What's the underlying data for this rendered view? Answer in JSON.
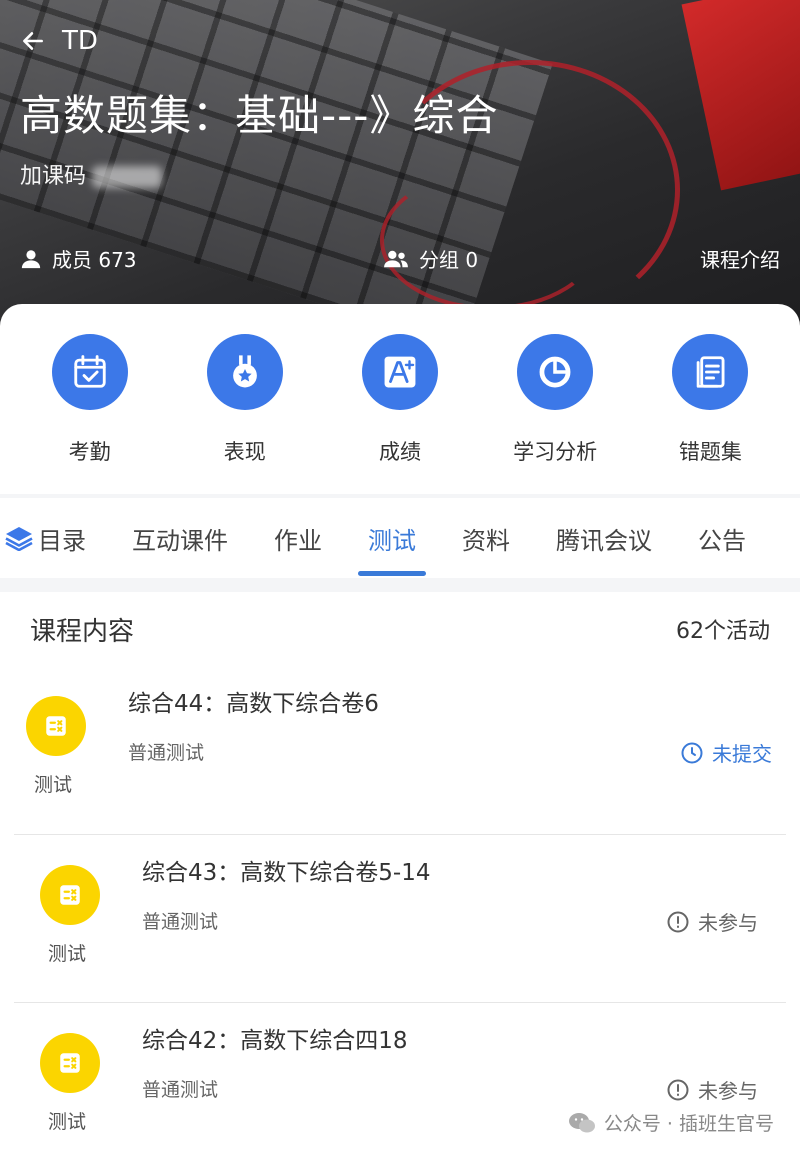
{
  "header": {
    "back_label": "TD",
    "title": "高数题集：基础---》综合",
    "course_code_label": "加课码",
    "members_label": "成员 673",
    "groups_label": "分组 0",
    "intro_label": "课程介绍"
  },
  "actions": [
    {
      "label": "考勤",
      "icon": "calendar-check-icon"
    },
    {
      "label": "表现",
      "icon": "medal-icon"
    },
    {
      "label": "成绩",
      "icon": "grade-a-plus-icon"
    },
    {
      "label": "学习分析",
      "icon": "pie-chart-icon"
    },
    {
      "label": "错题集",
      "icon": "notebook-icon"
    }
  ],
  "tabs": {
    "items": [
      "目录",
      "互动课件",
      "作业",
      "测试",
      "资料",
      "腾讯会议",
      "公告"
    ],
    "active": "测试"
  },
  "content": {
    "title": "课程内容",
    "count": "62个活动",
    "items": [
      {
        "type": "测试",
        "title": "综合44：高数下综合卷6",
        "subtitle": "普通测试",
        "status": "未提交",
        "status_icon": "clock-icon"
      },
      {
        "type": "测试",
        "title": "综合43：高数下综合卷5-14",
        "subtitle": "普通测试",
        "status": "未参与",
        "status_icon": "alert-circle-icon"
      },
      {
        "type": "测试",
        "title": "综合42：高数下综合四18",
        "subtitle": "普通测试",
        "status": "未参与",
        "status_icon": "alert-circle-icon"
      }
    ]
  },
  "watermark": "公众号 · 插班生官号",
  "colors": {
    "accent": "#3a7ad8",
    "action_circle": "#3c78e8",
    "badge": "#fbd500"
  }
}
